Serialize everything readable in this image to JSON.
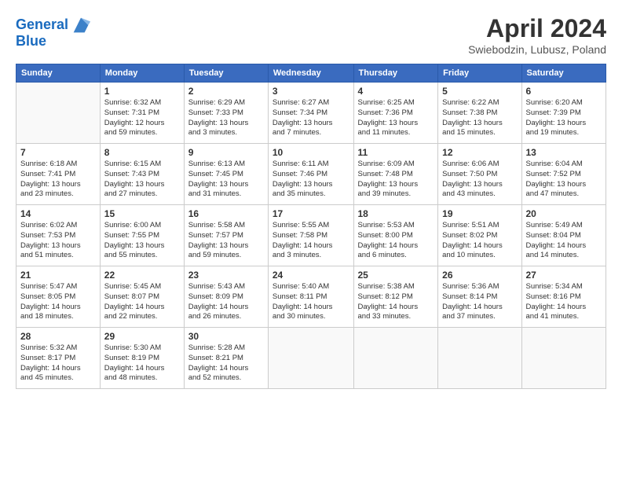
{
  "header": {
    "logo_line1": "General",
    "logo_line2": "Blue",
    "month": "April 2024",
    "location": "Swiebodzin, Lubusz, Poland"
  },
  "days_of_week": [
    "Sunday",
    "Monday",
    "Tuesday",
    "Wednesday",
    "Thursday",
    "Friday",
    "Saturday"
  ],
  "weeks": [
    [
      {
        "day": "",
        "info": ""
      },
      {
        "day": "1",
        "info": "Sunrise: 6:32 AM\nSunset: 7:31 PM\nDaylight: 12 hours\nand 59 minutes."
      },
      {
        "day": "2",
        "info": "Sunrise: 6:29 AM\nSunset: 7:33 PM\nDaylight: 13 hours\nand 3 minutes."
      },
      {
        "day": "3",
        "info": "Sunrise: 6:27 AM\nSunset: 7:34 PM\nDaylight: 13 hours\nand 7 minutes."
      },
      {
        "day": "4",
        "info": "Sunrise: 6:25 AM\nSunset: 7:36 PM\nDaylight: 13 hours\nand 11 minutes."
      },
      {
        "day": "5",
        "info": "Sunrise: 6:22 AM\nSunset: 7:38 PM\nDaylight: 13 hours\nand 15 minutes."
      },
      {
        "day": "6",
        "info": "Sunrise: 6:20 AM\nSunset: 7:39 PM\nDaylight: 13 hours\nand 19 minutes."
      }
    ],
    [
      {
        "day": "7",
        "info": "Sunrise: 6:18 AM\nSunset: 7:41 PM\nDaylight: 13 hours\nand 23 minutes."
      },
      {
        "day": "8",
        "info": "Sunrise: 6:15 AM\nSunset: 7:43 PM\nDaylight: 13 hours\nand 27 minutes."
      },
      {
        "day": "9",
        "info": "Sunrise: 6:13 AM\nSunset: 7:45 PM\nDaylight: 13 hours\nand 31 minutes."
      },
      {
        "day": "10",
        "info": "Sunrise: 6:11 AM\nSunset: 7:46 PM\nDaylight: 13 hours\nand 35 minutes."
      },
      {
        "day": "11",
        "info": "Sunrise: 6:09 AM\nSunset: 7:48 PM\nDaylight: 13 hours\nand 39 minutes."
      },
      {
        "day": "12",
        "info": "Sunrise: 6:06 AM\nSunset: 7:50 PM\nDaylight: 13 hours\nand 43 minutes."
      },
      {
        "day": "13",
        "info": "Sunrise: 6:04 AM\nSunset: 7:52 PM\nDaylight: 13 hours\nand 47 minutes."
      }
    ],
    [
      {
        "day": "14",
        "info": "Sunrise: 6:02 AM\nSunset: 7:53 PM\nDaylight: 13 hours\nand 51 minutes."
      },
      {
        "day": "15",
        "info": "Sunrise: 6:00 AM\nSunset: 7:55 PM\nDaylight: 13 hours\nand 55 minutes."
      },
      {
        "day": "16",
        "info": "Sunrise: 5:58 AM\nSunset: 7:57 PM\nDaylight: 13 hours\nand 59 minutes."
      },
      {
        "day": "17",
        "info": "Sunrise: 5:55 AM\nSunset: 7:58 PM\nDaylight: 14 hours\nand 3 minutes."
      },
      {
        "day": "18",
        "info": "Sunrise: 5:53 AM\nSunset: 8:00 PM\nDaylight: 14 hours\nand 6 minutes."
      },
      {
        "day": "19",
        "info": "Sunrise: 5:51 AM\nSunset: 8:02 PM\nDaylight: 14 hours\nand 10 minutes."
      },
      {
        "day": "20",
        "info": "Sunrise: 5:49 AM\nSunset: 8:04 PM\nDaylight: 14 hours\nand 14 minutes."
      }
    ],
    [
      {
        "day": "21",
        "info": "Sunrise: 5:47 AM\nSunset: 8:05 PM\nDaylight: 14 hours\nand 18 minutes."
      },
      {
        "day": "22",
        "info": "Sunrise: 5:45 AM\nSunset: 8:07 PM\nDaylight: 14 hours\nand 22 minutes."
      },
      {
        "day": "23",
        "info": "Sunrise: 5:43 AM\nSunset: 8:09 PM\nDaylight: 14 hours\nand 26 minutes."
      },
      {
        "day": "24",
        "info": "Sunrise: 5:40 AM\nSunset: 8:11 PM\nDaylight: 14 hours\nand 30 minutes."
      },
      {
        "day": "25",
        "info": "Sunrise: 5:38 AM\nSunset: 8:12 PM\nDaylight: 14 hours\nand 33 minutes."
      },
      {
        "day": "26",
        "info": "Sunrise: 5:36 AM\nSunset: 8:14 PM\nDaylight: 14 hours\nand 37 minutes."
      },
      {
        "day": "27",
        "info": "Sunrise: 5:34 AM\nSunset: 8:16 PM\nDaylight: 14 hours\nand 41 minutes."
      }
    ],
    [
      {
        "day": "28",
        "info": "Sunrise: 5:32 AM\nSunset: 8:17 PM\nDaylight: 14 hours\nand 45 minutes."
      },
      {
        "day": "29",
        "info": "Sunrise: 5:30 AM\nSunset: 8:19 PM\nDaylight: 14 hours\nand 48 minutes."
      },
      {
        "day": "30",
        "info": "Sunrise: 5:28 AM\nSunset: 8:21 PM\nDaylight: 14 hours\nand 52 minutes."
      },
      {
        "day": "",
        "info": ""
      },
      {
        "day": "",
        "info": ""
      },
      {
        "day": "",
        "info": ""
      },
      {
        "day": "",
        "info": ""
      }
    ]
  ]
}
